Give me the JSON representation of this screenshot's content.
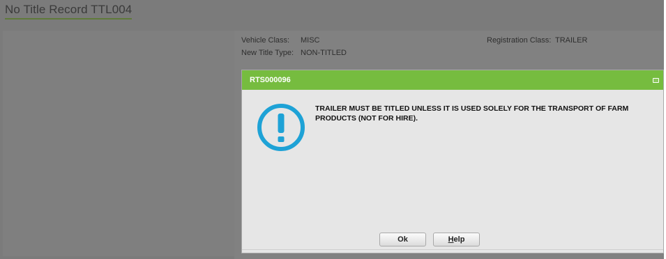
{
  "page": {
    "title": "No Title Record TTL004"
  },
  "form": {
    "vehicle_class_label": "Vehicle Class:",
    "vehicle_class_value": "MISC",
    "new_title_type_label": "New Title Type:",
    "new_title_type_value": "NON-TITLED",
    "registration_class_label": "Registration Class:",
    "registration_class_value": "TRAILER"
  },
  "dialog": {
    "title": "RTS000096",
    "icon": "exclamation-circle-icon",
    "message": "TRAILER MUST BE TITLED UNLESS IT IS USED SOLELY FOR THE TRANSPORT OF FARM PRODUCTS (NOT FOR HIRE).",
    "ok_label": "Ok",
    "help_accel": "H",
    "help_rest": "elp"
  },
  "colors": {
    "header_green": "#76bc3f",
    "icon_blue": "#1ea2d6",
    "overlay_gray": "#7b7b7b",
    "dialog_bg": "#e6e6e6"
  }
}
